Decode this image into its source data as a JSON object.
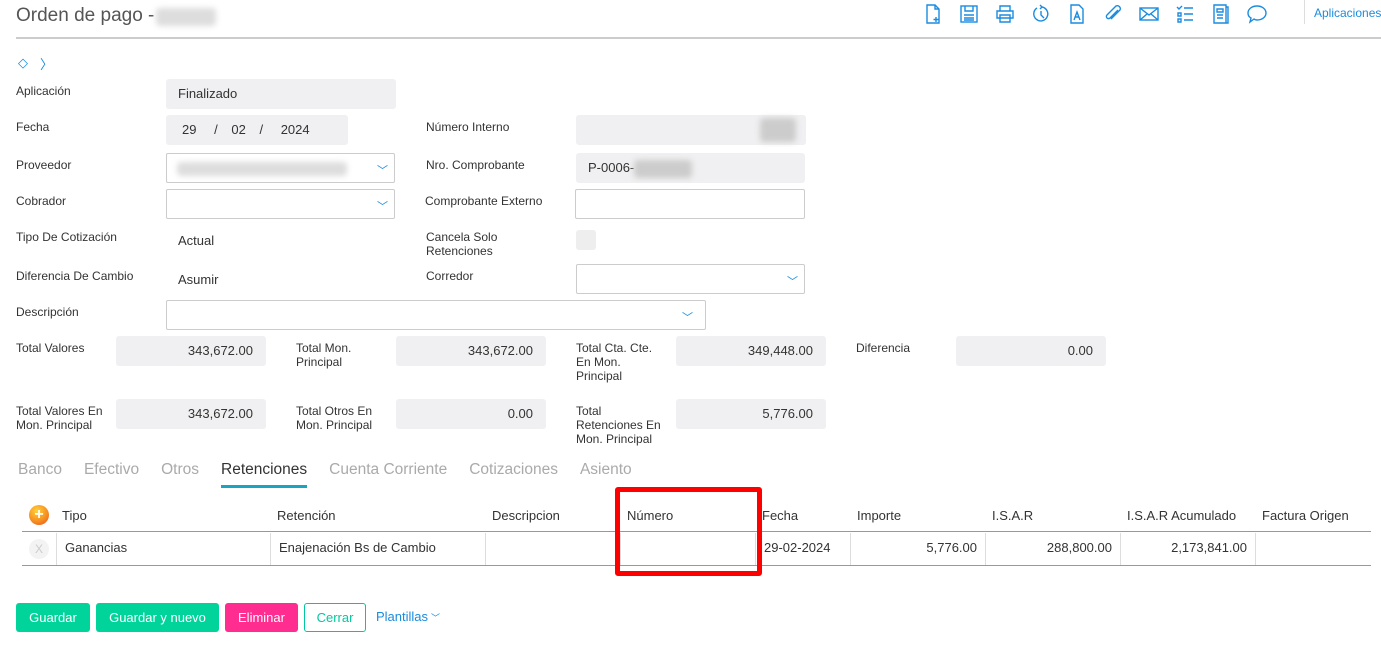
{
  "header": {
    "title": "Orden de pago -",
    "apps_label": "Aplicaciones",
    "toolbar_icons": [
      "new-document-icon",
      "save-icon",
      "print-icon",
      "history-icon",
      "document-a-icon",
      "attachment-icon",
      "mail-icon",
      "checklist-icon",
      "report-icon",
      "comment-icon"
    ]
  },
  "form": {
    "aplicacion_label": "Aplicación",
    "aplicacion": "Finalizado",
    "fecha_label": "Fecha",
    "fecha_dia": "29",
    "fecha_mes": "02",
    "fecha_anio": "2024",
    "sep": "/",
    "numero_interno_label": "Número Interno",
    "proveedor_label": "Proveedor",
    "nro_comprobante_label": "Nro. Comprobante",
    "nro_comprobante": "P-0006-",
    "cobrador_label": "Cobrador",
    "comprobante_externo_label": "Comprobante Externo",
    "tipo_cotizacion_label": "Tipo De Cotización",
    "tipo_cotizacion": "Actual",
    "cancela_label": "Cancela Solo Retenciones",
    "diferencia_cambio_label": "Diferencia De Cambio",
    "diferencia_cambio": "Asumir",
    "corredor_label": "Corredor",
    "descripcion_label": "Descripción"
  },
  "totals": {
    "total_valores_label": "Total Valores",
    "total_valores": "343,672.00",
    "total_mon_principal_label": "Total Mon. Principal",
    "total_mon_principal": "343,672.00",
    "total_cta_cte_label": "Total Cta. Cte. En Mon. Principal",
    "total_cta_cte": "349,448.00",
    "diferencia_label": "Diferencia",
    "diferencia": "0.00",
    "total_valores_mon_label": "Total Valores En Mon. Principal",
    "total_valores_mon": "343,672.00",
    "total_otros_label": "Total Otros En Mon. Principal",
    "total_otros": "0.00",
    "total_retenciones_label": "Total Retenciones En Mon. Principal",
    "total_retenciones": "5,776.00"
  },
  "tabs": [
    "Banco",
    "Efectivo",
    "Otros",
    "Retenciones",
    "Cuenta Corriente",
    "Cotizaciones",
    "Asiento"
  ],
  "table": {
    "headers": [
      "Tipo",
      "Retención",
      "Descripcion",
      "Número",
      "Fecha",
      "Importe",
      "I.S.A.R",
      "I.S.A.R Acumulado",
      "Factura Origen"
    ],
    "rows": [
      {
        "delete": "X",
        "tipo": "Ganancias",
        "retencion": "Enajenación Bs de Cambio",
        "descripcion": "",
        "numero": "",
        "fecha": "29-02-2024",
        "importe": "5,776.00",
        "isar": "288,800.00",
        "isar_acum": "2,173,841.00",
        "factura": ""
      }
    ]
  },
  "buttons": {
    "guardar": "Guardar",
    "guardar_nuevo": "Guardar y nuevo",
    "eliminar": "Eliminar",
    "cerrar": "Cerrar",
    "plantillas": "Plantillas"
  },
  "colors": {
    "accent": "#1a8ce0",
    "green": "#00d49a",
    "pink": "#ff2d8f",
    "highlight": "#ff0000"
  }
}
